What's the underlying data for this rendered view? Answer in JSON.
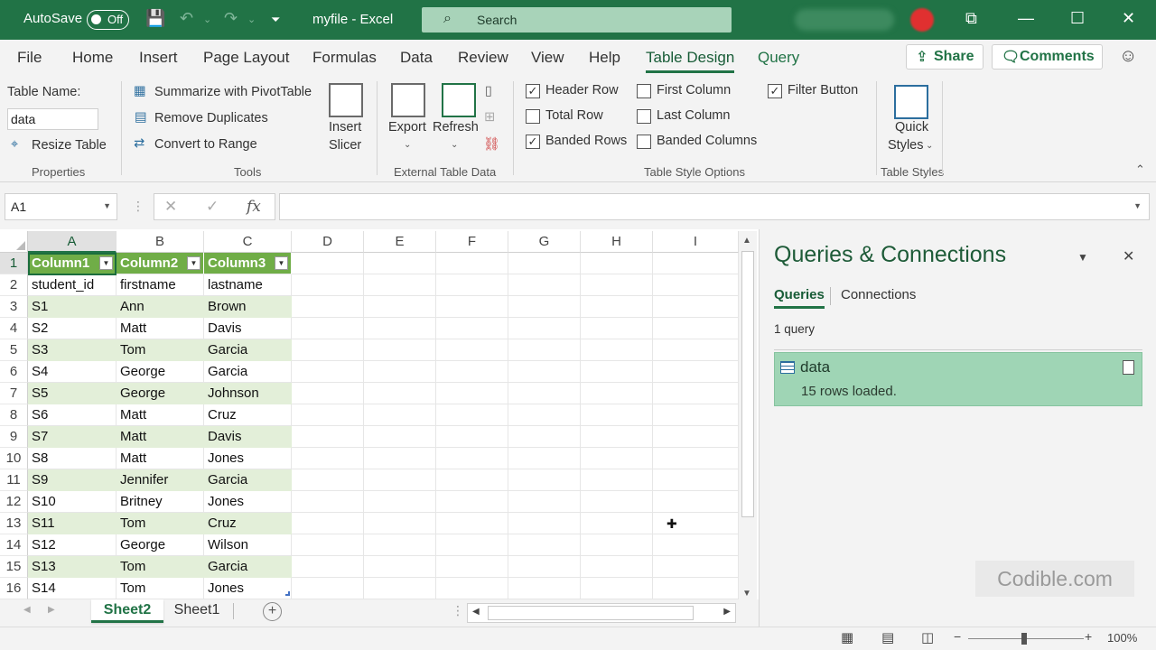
{
  "titlebar": {
    "autosave_label": "AutoSave",
    "autosave_state": "Off",
    "file_title": "myfile  -  Excel",
    "search_placeholder": "Search",
    "bg_color": "#217346"
  },
  "ribbon_tabs": [
    "File",
    "Home",
    "Insert",
    "Page Layout",
    "Formulas",
    "Data",
    "Review",
    "View",
    "Help",
    "Table Design",
    "Query"
  ],
  "active_tab": "Table Design",
  "share_label": "Share",
  "comments_label": "Comments",
  "ribbon": {
    "properties": {
      "table_name_label": "Table Name:",
      "table_name_value": "data",
      "resize_label": "Resize Table",
      "group_label": "Properties"
    },
    "tools": {
      "summarize_label": "Summarize with PivotTable",
      "remove_dup_label": "Remove Duplicates",
      "convert_label": "Convert to Range",
      "insert_slicer_line1": "Insert",
      "insert_slicer_line2": "Slicer",
      "group_label": "Tools"
    },
    "external": {
      "export_label": "Export",
      "refresh_label": "Refresh",
      "group_label": "External Table Data"
    },
    "style_options": {
      "header_row": {
        "label": "Header Row",
        "checked": true
      },
      "total_row": {
        "label": "Total Row",
        "checked": false
      },
      "banded_rows": {
        "label": "Banded Rows",
        "checked": true
      },
      "first_column": {
        "label": "First Column",
        "checked": false
      },
      "last_column": {
        "label": "Last Column",
        "checked": false
      },
      "banded_columns": {
        "label": "Banded Columns",
        "checked": false
      },
      "filter_button": {
        "label": "Filter Button",
        "checked": true
      },
      "group_label": "Table Style Options"
    },
    "styles": {
      "quick_line1": "Quick",
      "quick_line2": "Styles",
      "group_label": "Table Styles"
    }
  },
  "formula_bar": {
    "name_box": "A1",
    "cancel_glyph": "✕",
    "enter_glyph": "✓",
    "fx_glyph": "fx",
    "formula": ""
  },
  "grid": {
    "columns": [
      "A",
      "B",
      "C",
      "D",
      "E",
      "F",
      "G",
      "H",
      "I"
    ],
    "row_numbers": [
      "1",
      "2",
      "3",
      "4",
      "5",
      "6",
      "7",
      "8",
      "9",
      "10",
      "11",
      "12",
      "13",
      "14",
      "15",
      "16"
    ],
    "header": [
      "Column1",
      "Column2",
      "Column3"
    ],
    "rows": [
      [
        "student_id",
        "firstname",
        "lastname"
      ],
      [
        "S1",
        "Ann",
        "Brown"
      ],
      [
        "S2",
        "Matt",
        "Davis"
      ],
      [
        "S3",
        "Tom",
        "Garcia"
      ],
      [
        "S4",
        "George",
        "Garcia"
      ],
      [
        "S5",
        "George",
        "Johnson"
      ],
      [
        "S6",
        "Matt",
        "Cruz"
      ],
      [
        "S7",
        "Matt",
        "Davis"
      ],
      [
        "S8",
        "Matt",
        "Jones"
      ],
      [
        "S9",
        "Jennifer",
        "Garcia"
      ],
      [
        "S10",
        "Britney",
        "Jones"
      ],
      [
        "S11",
        "Tom",
        "Cruz"
      ],
      [
        "S12",
        "George",
        "Wilson"
      ],
      [
        "S13",
        "Tom",
        "Garcia"
      ],
      [
        "S14",
        "Tom",
        "Jones"
      ]
    ],
    "header_color": "#70ad47",
    "band_color": "#e3efd9"
  },
  "sheets": [
    "Sheet2",
    "Sheet1"
  ],
  "active_sheet": "Sheet2",
  "queries_pane": {
    "title": "Queries & Connections",
    "tabs": [
      "Queries",
      "Connections"
    ],
    "count_text": "1 query",
    "query_name": "data",
    "query_status": "15 rows loaded.",
    "watermark": "Codible.com"
  },
  "status_bar": {
    "zoom": "100%"
  }
}
